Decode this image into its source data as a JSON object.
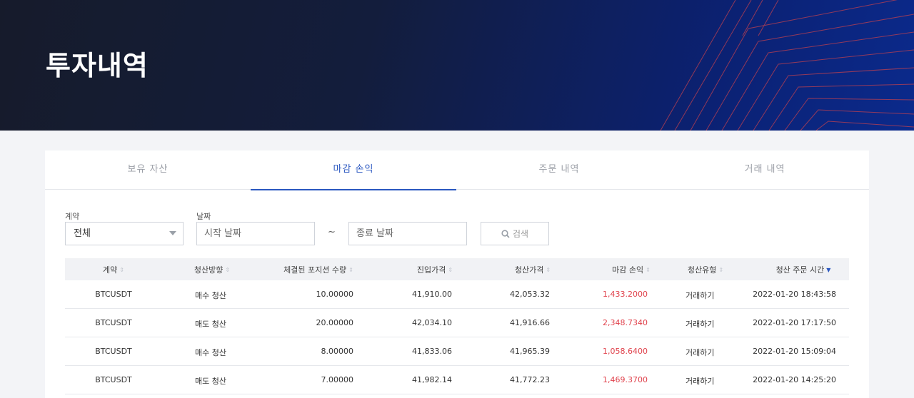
{
  "page": {
    "title": "투자내역"
  },
  "tabs": [
    {
      "label": "보유 자산",
      "active": false
    },
    {
      "label": "마감 손익",
      "active": true
    },
    {
      "label": "주문 내역",
      "active": false
    },
    {
      "label": "거래 내역",
      "active": false
    }
  ],
  "filters": {
    "contract_label": "계약",
    "contract_value": "전체",
    "date_label": "날짜",
    "start_placeholder": "시작 날짜",
    "separator": "~",
    "end_placeholder": "종료 날짜",
    "search_label": "검색",
    "search_icon": "search-icon"
  },
  "table": {
    "columns": [
      "계약",
      "청산방향",
      "체결된 포지션 수량",
      "진입가격",
      "청산가격",
      "마감 손익",
      "청산유형",
      "청산 주문 시간"
    ],
    "sorted_column": "청산 주문 시간",
    "rows": [
      {
        "contract": "BTCUSDT",
        "direction": "매수 청산",
        "qty": "10.00000",
        "entry": "41,910.00",
        "exit": "42,053.32",
        "pnl": "1,433.2000",
        "type": "거래하기",
        "time": "2022-01-20 18:43:58"
      },
      {
        "contract": "BTCUSDT",
        "direction": "매도 청산",
        "qty": "20.00000",
        "entry": "42,034.10",
        "exit": "41,916.66",
        "pnl": "2,348.7340",
        "type": "거래하기",
        "time": "2022-01-20 17:17:50"
      },
      {
        "contract": "BTCUSDT",
        "direction": "매수 청산",
        "qty": "8.00000",
        "entry": "41,833.06",
        "exit": "41,965.39",
        "pnl": "1,058.6400",
        "type": "거래하기",
        "time": "2022-01-20 15:09:04"
      },
      {
        "contract": "BTCUSDT",
        "direction": "매도 청산",
        "qty": "7.00000",
        "entry": "41,982.14",
        "exit": "41,772.23",
        "pnl": "1,469.3700",
        "type": "거래하기",
        "time": "2022-01-20 14:25:20"
      }
    ]
  },
  "colors": {
    "accent": "#2a57c0",
    "profit": "#e0434d",
    "hero_dark": "#161b2b",
    "hero_blue": "#0b2a8c"
  }
}
